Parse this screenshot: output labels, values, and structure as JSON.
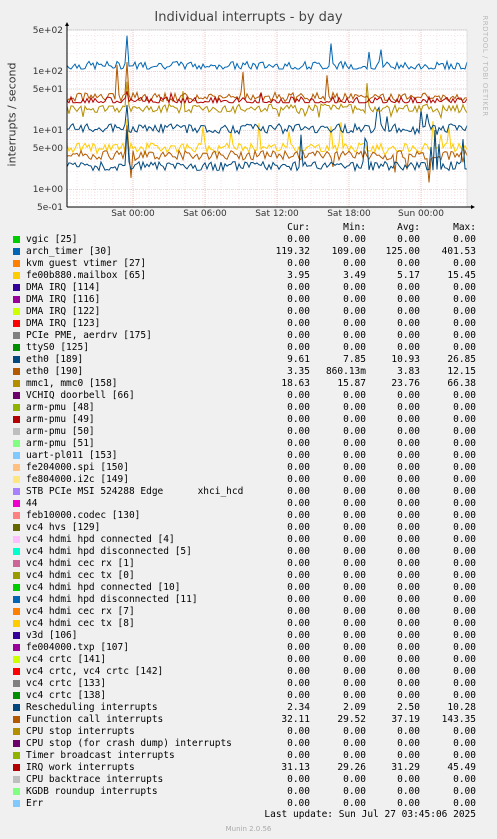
{
  "chart_data": {
    "type": "line",
    "title": "Individual interrupts - by day",
    "ylabel": "interrupts / second",
    "side_label": "RRDTOOL / TOBI OETIKER",
    "y_scale": "log",
    "ylim": [
      0.5,
      500
    ],
    "y_ticks": [
      "5e+02",
      "1e+02",
      "5e+01",
      "1e+01",
      "5e+00",
      "1e+00",
      "5e-01"
    ],
    "x_ticks": [
      "Sat 00:00",
      "Sat 06:00",
      "Sat 12:00",
      "Sat 18:00",
      "Sun 00:00"
    ],
    "grid": true,
    "columns": [
      "Cur:",
      "Min:",
      "Avg:",
      "Max:"
    ],
    "series": [
      {
        "name": "vgic [25]",
        "color": "#00cc00",
        "values": [
          "0.00",
          "0.00",
          "0.00",
          "0.00"
        ]
      },
      {
        "name": "arch_timer [30]",
        "color": "#0066b3",
        "values": [
          "119.32",
          "109.00",
          "125.00",
          "401.53"
        ]
      },
      {
        "name": "kvm guest vtimer [27]",
        "color": "#ff8000",
        "values": [
          "0.00",
          "0.00",
          "0.00",
          "0.00"
        ]
      },
      {
        "name": "fe00b880.mailbox [65]",
        "color": "#ffcc00",
        "values": [
          "3.95",
          "3.49",
          "5.17",
          "15.45"
        ]
      },
      {
        "name": "DMA IRQ [114]",
        "color": "#330099",
        "values": [
          "0.00",
          "0.00",
          "0.00",
          "0.00"
        ]
      },
      {
        "name": "DMA IRQ [116]",
        "color": "#990099",
        "values": [
          "0.00",
          "0.00",
          "0.00",
          "0.00"
        ]
      },
      {
        "name": "DMA IRQ [122]",
        "color": "#ccff00",
        "values": [
          "0.00",
          "0.00",
          "0.00",
          "0.00"
        ]
      },
      {
        "name": "DMA IRQ [123]",
        "color": "#ff0000",
        "values": [
          "0.00",
          "0.00",
          "0.00",
          "0.00"
        ]
      },
      {
        "name": "PCIe PME, aerdrv [175]",
        "color": "#808080",
        "values": [
          "0.00",
          "0.00",
          "0.00",
          "0.00"
        ]
      },
      {
        "name": "ttyS0 [125]",
        "color": "#008f00",
        "values": [
          "0.00",
          "0.00",
          "0.00",
          "0.00"
        ]
      },
      {
        "name": "eth0 [189]",
        "color": "#00487d",
        "values": [
          "9.61",
          "7.85",
          "10.93",
          "26.85"
        ]
      },
      {
        "name": "eth0 [190]",
        "color": "#b35a00",
        "values": [
          "3.35",
          "860.13m",
          "3.83",
          "12.15"
        ]
      },
      {
        "name": "mmc1, mmc0 [158]",
        "color": "#b38f00",
        "values": [
          "18.63",
          "15.87",
          "23.76",
          "66.38"
        ]
      },
      {
        "name": "VCHIQ doorbell [66]",
        "color": "#6b006b",
        "values": [
          "0.00",
          "0.00",
          "0.00",
          "0.00"
        ]
      },
      {
        "name": "arm-pmu [48]",
        "color": "#8fb300",
        "values": [
          "0.00",
          "0.00",
          "0.00",
          "0.00"
        ]
      },
      {
        "name": "arm-pmu [49]",
        "color": "#b30000",
        "values": [
          "0.00",
          "0.00",
          "0.00",
          "0.00"
        ]
      },
      {
        "name": "arm-pmu [50]",
        "color": "#bebebe",
        "values": [
          "0.00",
          "0.00",
          "0.00",
          "0.00"
        ]
      },
      {
        "name": "arm-pmu [51]",
        "color": "#80ff80",
        "values": [
          "0.00",
          "0.00",
          "0.00",
          "0.00"
        ]
      },
      {
        "name": "uart-pl011 [153]",
        "color": "#80c9ff",
        "values": [
          "0.00",
          "0.00",
          "0.00",
          "0.00"
        ]
      },
      {
        "name": "fe204000.spi [150]",
        "color": "#ffc080",
        "values": [
          "0.00",
          "0.00",
          "0.00",
          "0.00"
        ]
      },
      {
        "name": "fe804000.i2c [149]",
        "color": "#ffe680",
        "values": [
          "0.00",
          "0.00",
          "0.00",
          "0.00"
        ]
      },
      {
        "name": "STB PCIe MSI 524288 Edge      xhci_hcd",
        "color": "#aa80ff",
        "values": [
          "0.00",
          "0.00",
          "0.00",
          "0.00"
        ]
      },
      {
        "name": "44",
        "color": "#ee00cc",
        "values": [
          "0.00",
          "0.00",
          "0.00",
          "0.00"
        ]
      },
      {
        "name": "feb10000.codec [130]",
        "color": "#ff8080",
        "values": [
          "0.00",
          "0.00",
          "0.00",
          "0.00"
        ]
      },
      {
        "name": "vc4 hvs [129]",
        "color": "#666600",
        "values": [
          "0.00",
          "0.00",
          "0.00",
          "0.00"
        ]
      },
      {
        "name": "vc4 hdmi hpd connected [4]",
        "color": "#ffbfff",
        "values": [
          "0.00",
          "0.00",
          "0.00",
          "0.00"
        ]
      },
      {
        "name": "vc4 hdmi hpd disconnected [5]",
        "color": "#00ffcc",
        "values": [
          "0.00",
          "0.00",
          "0.00",
          "0.00"
        ]
      },
      {
        "name": "vc4 hdmi cec rx [1]",
        "color": "#cc6699",
        "values": [
          "0.00",
          "0.00",
          "0.00",
          "0.00"
        ]
      },
      {
        "name": "vc4 hdmi cec tx [0]",
        "color": "#999900",
        "values": [
          "0.00",
          "0.00",
          "0.00",
          "0.00"
        ]
      },
      {
        "name": "vc4 hdmi hpd connected [10]",
        "color": "#00cc00",
        "values": [
          "0.00",
          "0.00",
          "0.00",
          "0.00"
        ]
      },
      {
        "name": "vc4 hdmi hpd disconnected [11]",
        "color": "#0066b3",
        "values": [
          "0.00",
          "0.00",
          "0.00",
          "0.00"
        ]
      },
      {
        "name": "vc4 hdmi cec rx [7]",
        "color": "#ff8000",
        "values": [
          "0.00",
          "0.00",
          "0.00",
          "0.00"
        ]
      },
      {
        "name": "vc4 hdmi cec tx [8]",
        "color": "#ffcc00",
        "values": [
          "0.00",
          "0.00",
          "0.00",
          "0.00"
        ]
      },
      {
        "name": "v3d [106]",
        "color": "#330099",
        "values": [
          "0.00",
          "0.00",
          "0.00",
          "0.00"
        ]
      },
      {
        "name": "fe004000.txp [107]",
        "color": "#990099",
        "values": [
          "0.00",
          "0.00",
          "0.00",
          "0.00"
        ]
      },
      {
        "name": "vc4 crtc [141]",
        "color": "#ccff00",
        "values": [
          "0.00",
          "0.00",
          "0.00",
          "0.00"
        ]
      },
      {
        "name": "vc4 crtc, vc4 crtc [142]",
        "color": "#ff0000",
        "values": [
          "0.00",
          "0.00",
          "0.00",
          "0.00"
        ]
      },
      {
        "name": "vc4 crtc [133]",
        "color": "#808080",
        "values": [
          "0.00",
          "0.00",
          "0.00",
          "0.00"
        ]
      },
      {
        "name": "vc4 crtc [138]",
        "color": "#008f00",
        "values": [
          "0.00",
          "0.00",
          "0.00",
          "0.00"
        ]
      },
      {
        "name": "Rescheduling interrupts",
        "color": "#00487d",
        "values": [
          "2.34",
          "2.09",
          "2.50",
          "10.28"
        ]
      },
      {
        "name": "Function call interrupts",
        "color": "#b35a00",
        "values": [
          "32.11",
          "29.52",
          "37.19",
          "143.35"
        ]
      },
      {
        "name": "CPU stop interrupts",
        "color": "#b38f00",
        "values": [
          "0.00",
          "0.00",
          "0.00",
          "0.00"
        ]
      },
      {
        "name": "CPU stop (for crash dump) interrupts",
        "color": "#6b006b",
        "values": [
          "0.00",
          "0.00",
          "0.00",
          "0.00"
        ]
      },
      {
        "name": "Timer broadcast interrupts",
        "color": "#8fb300",
        "values": [
          "0.00",
          "0.00",
          "0.00",
          "0.00"
        ]
      },
      {
        "name": "IRQ work interrupts",
        "color": "#b30000",
        "values": [
          "31.13",
          "29.26",
          "31.29",
          "45.49"
        ]
      },
      {
        "name": "CPU backtrace interrupts",
        "color": "#bebebe",
        "values": [
          "0.00",
          "0.00",
          "0.00",
          "0.00"
        ]
      },
      {
        "name": "KGDB roundup interrupts",
        "color": "#80ff80",
        "values": [
          "0.00",
          "0.00",
          "0.00",
          "0.00"
        ]
      },
      {
        "name": "Err",
        "color": "#80c9ff",
        "values": [
          "0.00",
          "0.00",
          "0.00",
          "0.00"
        ]
      }
    ]
  },
  "footer": {
    "last_update": "Last update: Sun Jul 27 03:45:06 2025",
    "generator": "Munin 2.0.56"
  }
}
